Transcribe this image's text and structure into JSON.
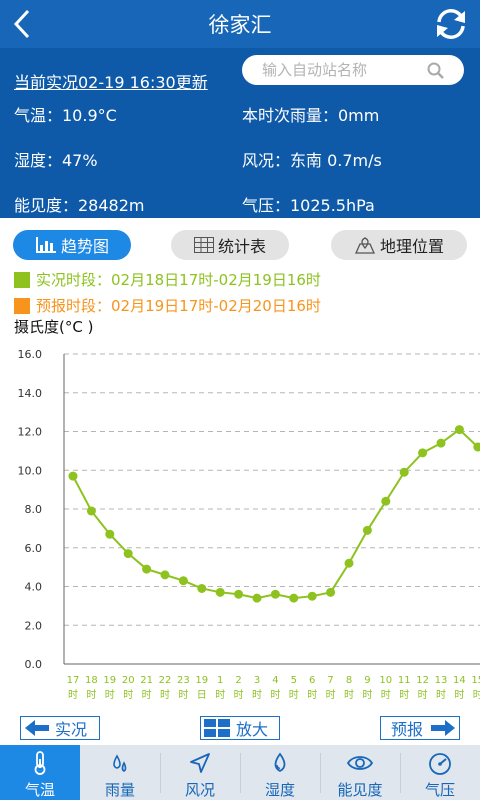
{
  "header": {
    "title": "徐家汇"
  },
  "info": {
    "updated": "当前实况02-19 16:30更新",
    "search_placeholder": "输入自动站名称",
    "temperature": "气温：10.9°C",
    "rainfall": "本时次雨量：0mm",
    "humidity": "湿度：47%",
    "wind": "风况：东南  0.7m/s",
    "visibility": "能见度：28482m",
    "pressure": "气压：1025.5hPa"
  },
  "tabs": {
    "trend": "趋势图",
    "stats": "统计表",
    "location": "地理位置"
  },
  "legend": {
    "observed": "实况时段：02月18日17时-02月19日16时",
    "forecast": "预报时段：02月19日17时-02月20日16时"
  },
  "colors": {
    "observed": "#8dc21f",
    "forecast": "#f7941d",
    "accent": "#1766b7"
  },
  "chart_data": {
    "type": "line",
    "ylabel": "摄氏度(°C )",
    "ylim": [
      0,
      16
    ],
    "yticks": [
      "0.0",
      "2.0",
      "4.0",
      "6.0",
      "8.0",
      "10.0",
      "12.0",
      "14.0",
      "16.0"
    ],
    "x_hours": [
      "17",
      "18",
      "19",
      "20",
      "21",
      "22",
      "23",
      "19",
      "1",
      "2",
      "3",
      "4",
      "5",
      "6",
      "7",
      "8",
      "9",
      "10",
      "11",
      "12",
      "13",
      "14",
      "15"
    ],
    "x_units": [
      "时",
      "时",
      "时",
      "时",
      "时",
      "时",
      "时",
      "日",
      "时",
      "时",
      "时",
      "时",
      "时",
      "时",
      "时",
      "时",
      "时",
      "时",
      "时",
      "时",
      "时",
      "时",
      "时"
    ],
    "values": [
      9.7,
      7.9,
      6.7,
      5.7,
      4.9,
      4.6,
      4.3,
      3.9,
      3.7,
      3.6,
      3.4,
      3.6,
      3.4,
      3.5,
      3.7,
      5.2,
      6.9,
      8.4,
      9.9,
      10.9,
      11.4,
      12.1,
      11.2
    ]
  },
  "nav": {
    "prev": "实况",
    "zoom": "放大",
    "next": "预报"
  },
  "bottom": [
    "气温",
    "雨量",
    "风况",
    "湿度",
    "能见度",
    "气压"
  ]
}
